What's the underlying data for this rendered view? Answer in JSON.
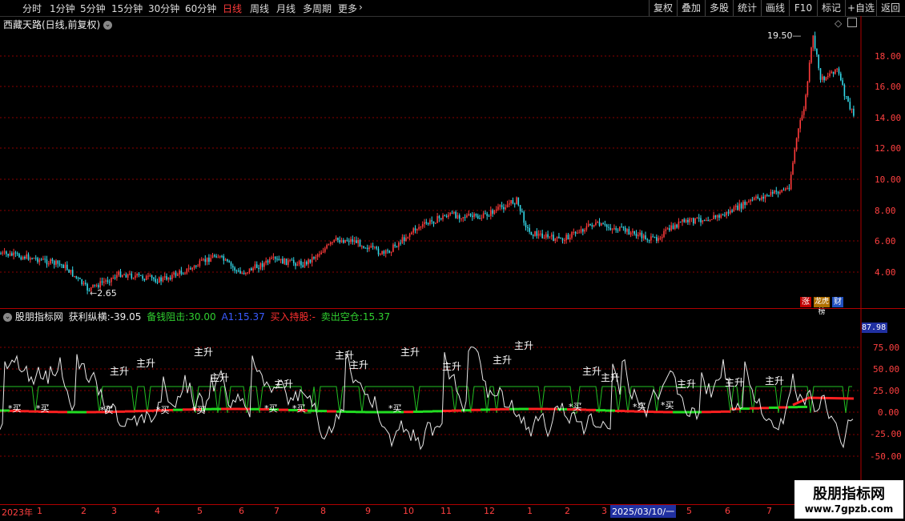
{
  "toolbar": {
    "periods": [
      "分时",
      "1分钟",
      "5分钟",
      "15分钟",
      "30分钟",
      "60分钟",
      "日线",
      "周线",
      "月线",
      "多周期",
      "更多"
    ],
    "active": "日线",
    "more_arrow": "›",
    "right_buttons": [
      "复权",
      "叠加",
      "多股",
      "统计",
      "画线",
      "F10",
      "标记",
      "+自选",
      "返回"
    ]
  },
  "main_panel": {
    "title": "西藏天路(日线,前复权)",
    "high_label": "19.50",
    "low_label": "2.65",
    "y_ticks": [
      "18.00",
      "16.00",
      "14.00",
      "12.00",
      "10.00",
      "8.00",
      "6.00",
      "4.00"
    ],
    "badges": [
      "涨",
      "龙虎榜",
      "财"
    ]
  },
  "indicator": {
    "name": "股朋指标网",
    "fields": [
      {
        "label": "获利纵横:",
        "value": "-39.05",
        "color": "#e0e0e0"
      },
      {
        "label": "备钱阻击:",
        "value": "30.00",
        "color": "#30d030"
      },
      {
        "label": "A1:",
        "value": "15.37",
        "color": "#3a5bff"
      },
      {
        "label": "买入持股:",
        "value": "-",
        "color": "#ff3030"
      },
      {
        "label": "卖出空仓:",
        "value": "15.37",
        "color": "#30d030"
      }
    ],
    "current_value": "87.98",
    "y_ticks": [
      "75.00",
      "50.00",
      "25.00",
      "0.00",
      "-25.00",
      "-50.00"
    ],
    "signal_rise": "主升",
    "signal_buy": "买"
  },
  "time_axis": {
    "labels": [
      "2023年",
      "1",
      "2",
      "3",
      "4",
      "5",
      "6",
      "7",
      "8",
      "9",
      "10",
      "11",
      "12",
      "1",
      "2",
      "3",
      "2025/03/10/一",
      "5",
      "6",
      "7"
    ]
  },
  "watermark": {
    "title": "股朋指标网",
    "url": "www.7gpzb.com"
  }
}
